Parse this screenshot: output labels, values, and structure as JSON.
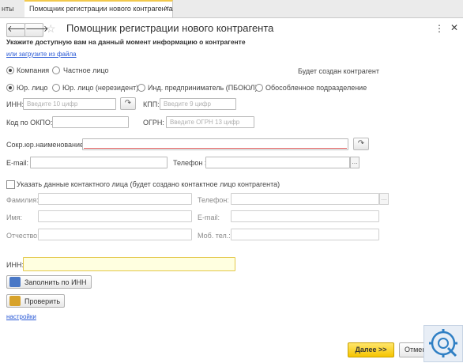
{
  "tabs": {
    "prev_label": "нты",
    "active_label": "Помощник регистрации нового контрагента"
  },
  "window": {
    "title": "Помощник регистрации нового контрагента"
  },
  "hint": "Укажите доступную вам на данный момент информацию о контрагенте",
  "load_link": "или загрузите из файла",
  "kind": {
    "company": "Компания",
    "private": "Частное лицо",
    "will_create": "Будет создан контрагент"
  },
  "type": {
    "legal": "Юр. лицо",
    "legal_nonres": "Юр. лицо (нерезидент)",
    "entrepreneur": "Инд. предприниматель (ПБОЮЛ)",
    "branch": "Обособленное подразделение"
  },
  "fields": {
    "inn_label": "ИНН:",
    "inn_ph": "Введите 10 цифр",
    "kpp_label": "КПП:",
    "kpp_ph": "Введите 9 цифр",
    "okpo_label": "Код по ОКПО:",
    "ogrn_label": "ОГРН:",
    "ogrn_ph": "Введите ОГРН 13 цифр",
    "short_name_label": "Сокр.юр.наименование:",
    "email_label": "E-mail:",
    "phone_label": "Телефон :"
  },
  "contact": {
    "checkbox_label": "Указать данные контактного лица (будет создано контактное лицо контрагента)",
    "surname": "Фамилия:",
    "name": "Имя:",
    "patronymic": "Отчество:",
    "phone": "Телефон:",
    "email": "E-mail:",
    "mobile": "Моб. тел.:"
  },
  "inn_block": {
    "label": "ИНН:"
  },
  "buttons": {
    "fill_by_inn": "Заполнить по ИНН",
    "check": "Проверить",
    "next": "Далее >>",
    "cancel": "Отмена"
  },
  "settings_link": "настройки",
  "glyphs": {
    "back": "🡐",
    "forward": "🡒",
    "star": "☆",
    "dots": "⋮",
    "close": "✕",
    "tab_close": "×",
    "refresh": "↷",
    "ellipsis": "..."
  },
  "colors": {
    "accent_yellow": "#f5c400",
    "inn_field_bg": "#ffffe0",
    "link": "#2a5ad6"
  }
}
